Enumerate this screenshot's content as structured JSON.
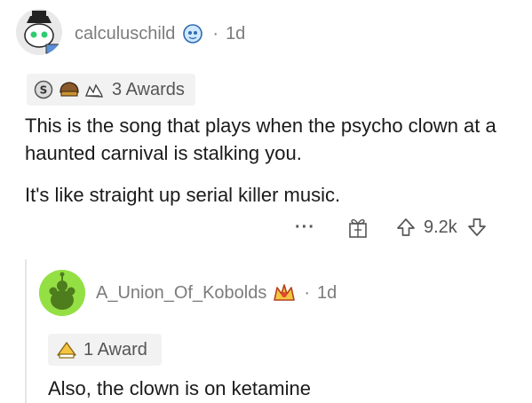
{
  "comment": {
    "username": "calculuschild",
    "separator": "·",
    "age": "1d",
    "awards_label": "3 Awards",
    "paragraphs": [
      "This is the song that plays when the psycho clown at a haunted carnival is stalking you.",
      "It's like straight up serial killer music."
    ],
    "actions": {
      "more": "···",
      "score": "9.2k"
    },
    "icons": [
      "avatar",
      "flair-icon",
      "silver-award-icon",
      "helmet-award-icon",
      "hands-award-icon",
      "more-options-icon",
      "give-award-icon",
      "upvote-icon",
      "downvote-icon"
    ]
  },
  "reply": {
    "username": "A_Union_Of_Kobolds",
    "separator": "·",
    "age": "1d",
    "awards_label": "1 Award",
    "paragraphs": [
      "Also, the clown is on ketamine"
    ],
    "icons": [
      "avatar",
      "flair-icon",
      "award-icon"
    ]
  },
  "colors": {
    "meta_gray": "#7c7c7c",
    "text": "#1a1a1b",
    "award_bg": "#f2f2f2",
    "reply_avatar_bg": "#94e044",
    "thread_line": "#e6e6e6"
  }
}
